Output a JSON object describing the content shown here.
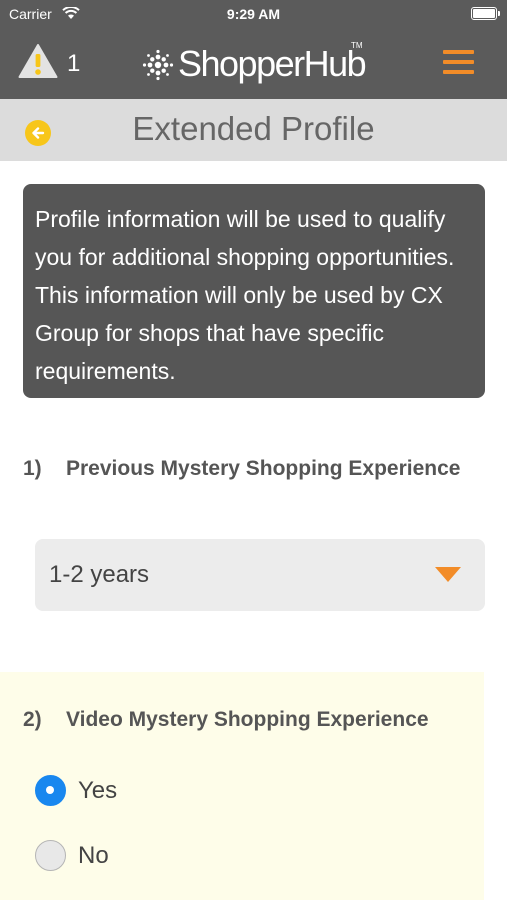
{
  "status_bar": {
    "carrier": "Carrier",
    "time": "9:29 AM"
  },
  "navbar": {
    "alert_count": "1",
    "brand": "ShopperHub",
    "brand_tm": "TM",
    "accent_color": "#f28c28"
  },
  "header": {
    "title": "Extended Profile"
  },
  "info": {
    "text": "Profile information will be used to qualify you for additional shopping opportunities. This information will only be used by CX Group for shops that have specific requirements."
  },
  "questions": [
    {
      "number": "1)",
      "label": "Previous Mystery Shopping Experience",
      "selected_value": "1-2 years"
    },
    {
      "number": "2)",
      "label": "Video Mystery Shopping Experience",
      "options": [
        {
          "label": "Yes",
          "selected": true
        },
        {
          "label": "No",
          "selected": false
        }
      ]
    }
  ]
}
